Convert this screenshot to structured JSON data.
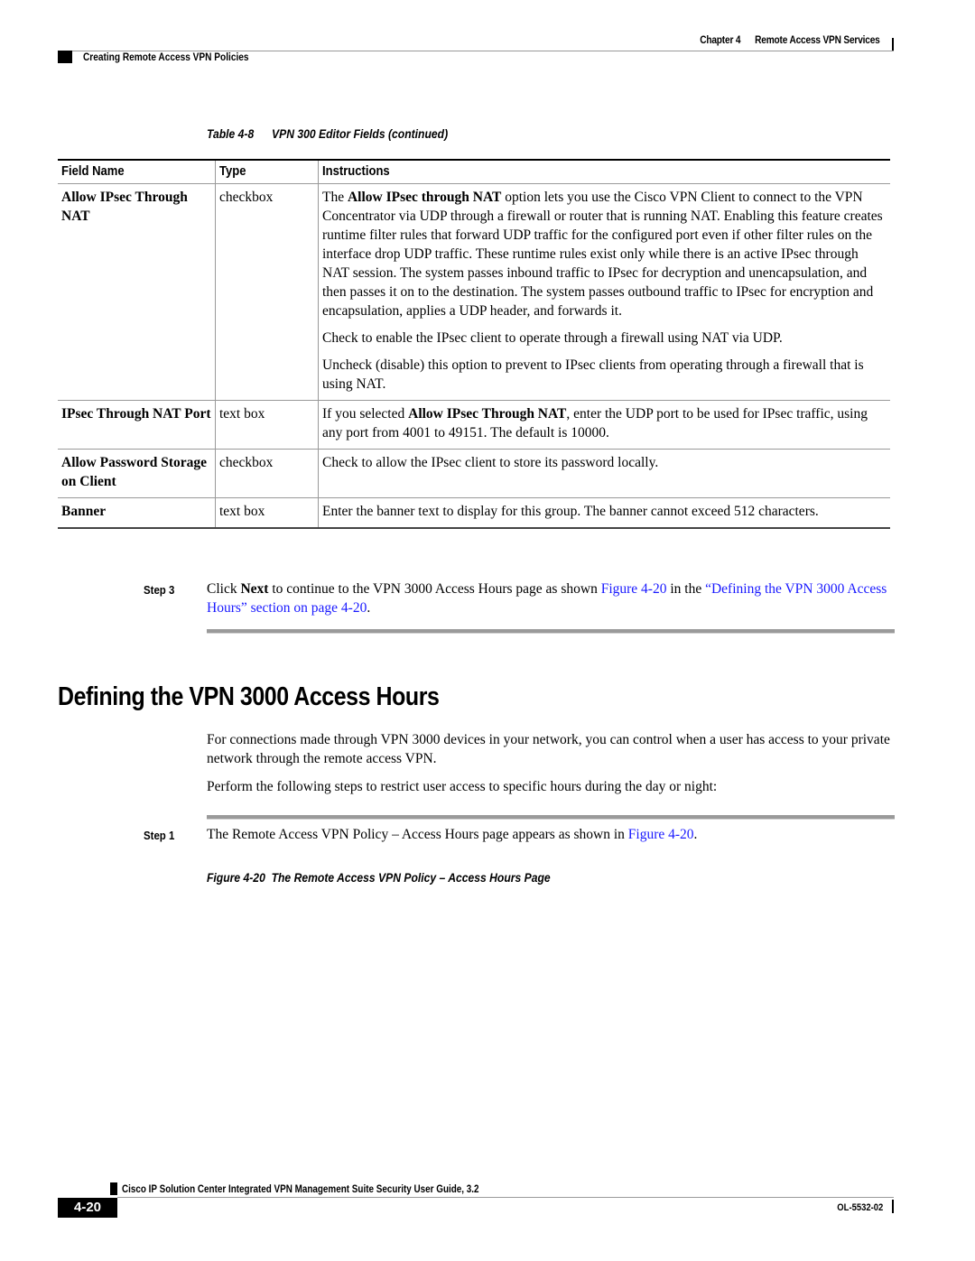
{
  "header": {
    "chapter": "Chapter 4",
    "chapter_title": "Remote Access VPN Services",
    "section": "Creating Remote Access VPN Policies"
  },
  "table": {
    "number": "Table 4-8",
    "title": "VPN 300 Editor Fields (continued)",
    "columns": [
      "Field Name",
      "Type",
      "Instructions"
    ],
    "rows": [
      {
        "field": "Allow IPsec Through NAT",
        "type": "checkbox",
        "instructions": [
          {
            "pre": "The ",
            "bold": "Allow IPsec through NAT",
            "post": " option lets you use the Cisco VPN Client to connect to the VPN Concentrator via UDP through a firewall or router that is running NAT. Enabling this feature creates runtime filter rules that forward UDP traffic for the configured port even if other filter rules on the interface drop UDP traffic. These runtime rules exist only while there is an active IPsec through NAT session. The system passes inbound traffic to IPsec for decryption and unencapsulation, and then passes it on to the destination. The system passes outbound traffic to IPsec for encryption and encapsulation, applies a UDP header, and forwards it."
          },
          {
            "pre": "Check to enable the IPsec client to operate through a firewall using NAT via UDP.",
            "bold": "",
            "post": ""
          },
          {
            "pre": "Uncheck (disable) this option to prevent to IPsec clients from operating through a firewall that is using NAT.",
            "bold": "",
            "post": ""
          }
        ]
      },
      {
        "field": "IPsec Through NAT Port",
        "type": "text box",
        "instructions": [
          {
            "pre": "If you selected ",
            "bold": "Allow IPsec Through NAT",
            "post": ", enter the UDP port to be used for IPsec traffic, using any port from 4001 to 49151. The default is 10000."
          }
        ]
      },
      {
        "field": "Allow Password Storage on Client",
        "type": "checkbox",
        "instructions": [
          {
            "pre": "Check to allow the IPsec client to store its password locally.",
            "bold": "",
            "post": ""
          }
        ]
      },
      {
        "field": "Banner",
        "type": "text box",
        "instructions": [
          {
            "pre": "Enter the banner text to display for this group. The banner cannot exceed 512 characters.",
            "bold": "",
            "post": ""
          }
        ]
      }
    ]
  },
  "step3": {
    "label": "Step 3",
    "t1": "Click ",
    "bold": "Next",
    "t2": " to continue to the VPN 3000 Access Hours page as shown ",
    "link1": "Figure 4-20",
    "t3": " in the ",
    "link2": "“Defining the VPN 3000 Access Hours” section on page 4-20",
    "t4": "."
  },
  "section": {
    "heading": "Defining the VPN 3000 Access Hours",
    "para1": "For connections made through VPN 3000 devices in your network, you can control when a user has access to your private network through the remote access VPN.",
    "para2": "Perform the following steps to restrict user access to specific hours during the day or night:"
  },
  "step1": {
    "label": "Step 1",
    "t1": "The Remote Access VPN Policy – Access Hours page appears as shown in ",
    "link": "Figure 4-20",
    "t2": "."
  },
  "figure": {
    "number": "Figure 4-20",
    "title": "The Remote Access VPN Policy – Access Hours Page"
  },
  "footer": {
    "book_title": "Cisco IP Solution Center Integrated VPN Management Suite Security User Guide, 3.2",
    "page_number": "4-20",
    "doc_number": "OL-5532-02"
  },
  "colors": {
    "link": "#1a1aff",
    "rule": "#999999"
  }
}
